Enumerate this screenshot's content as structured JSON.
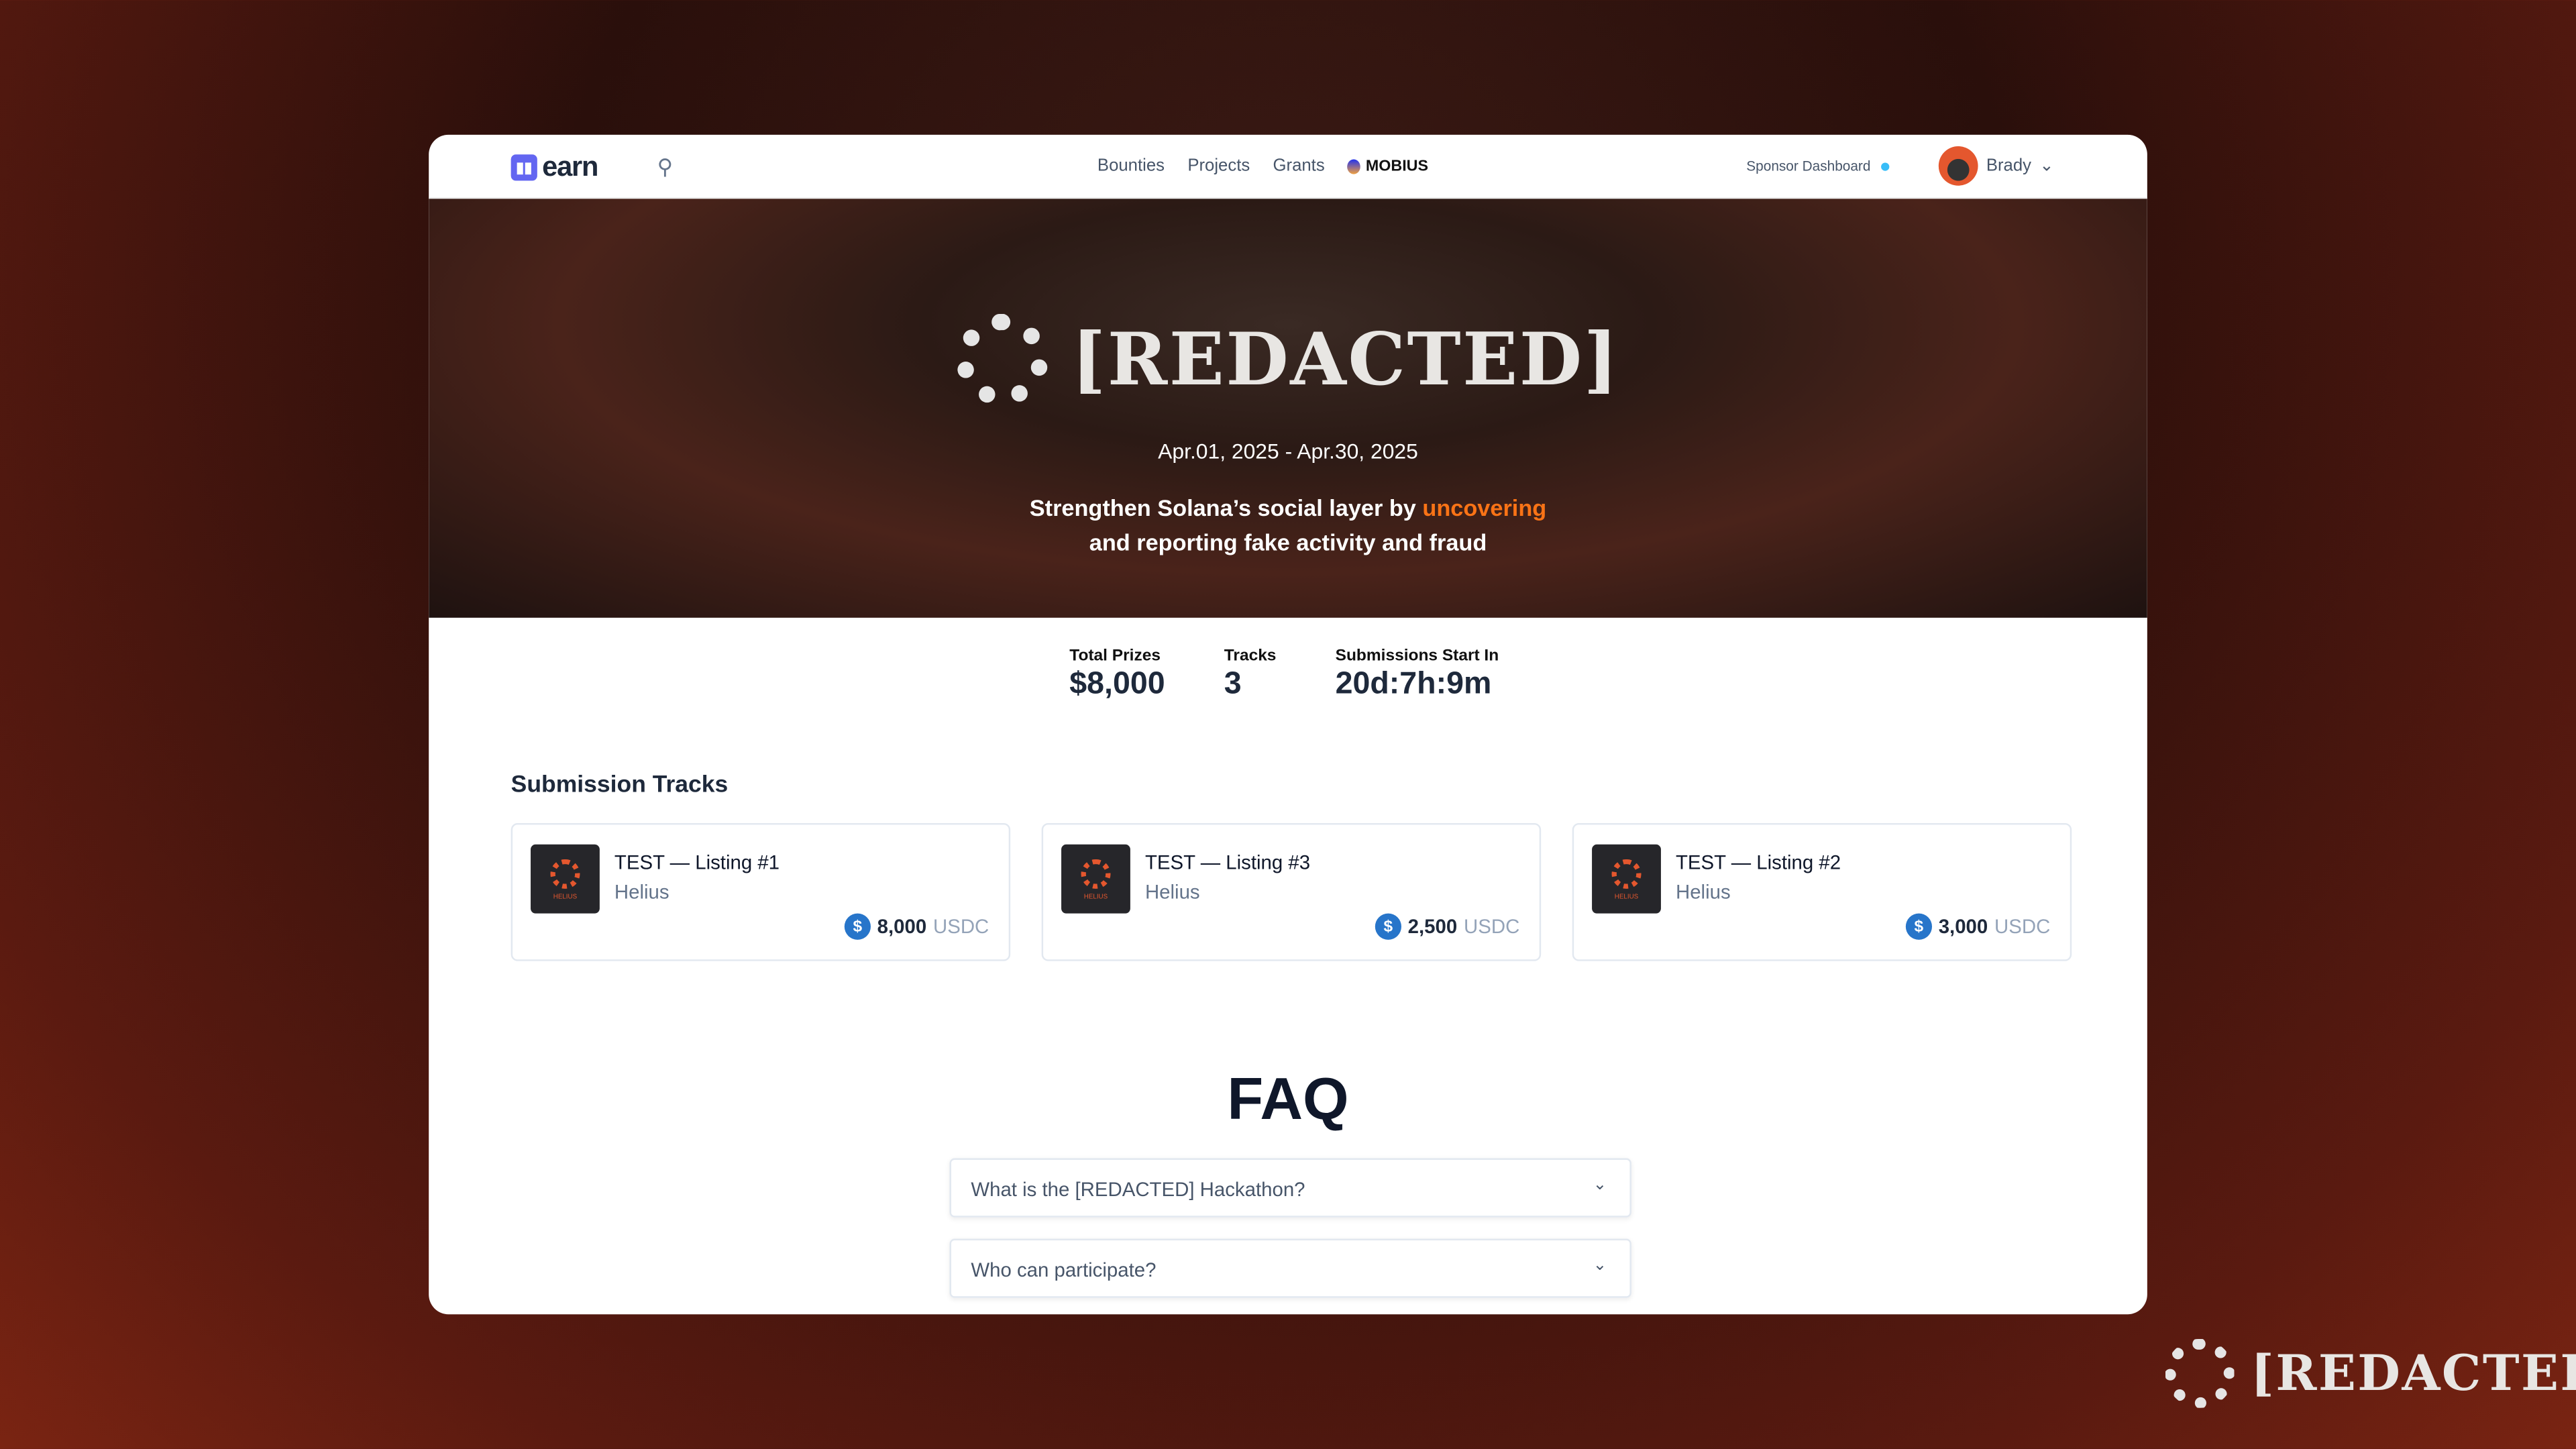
{
  "nav": {
    "logo": "earn",
    "links": [
      "Bounties",
      "Projects",
      "Grants"
    ],
    "mobius": "MOBIUS",
    "sponsor": "Sponsor Dashboard",
    "user": "Brady"
  },
  "hero": {
    "title": "[REDACTED]",
    "dates": "Apr.01, 2025 - Apr.30, 2025",
    "tagline_pre": "Strengthen Solana’s social layer by ",
    "tagline_hl": "uncovering",
    "tagline_post": " and reporting fake activity and fraud",
    "accent": "#f97316"
  },
  "stats": [
    {
      "label": "Total Prizes",
      "value": "$8,000"
    },
    {
      "label": "Tracks",
      "value": "3"
    },
    {
      "label": "Submissions Start In",
      "value": "20d:7h:9m"
    }
  ],
  "tracks_heading": "Submission Tracks",
  "tracks": [
    {
      "title": "TEST — Listing #1",
      "sponsor": "Helius",
      "amount": "8,000",
      "token": "USDC",
      "logo_text": "HELIUS"
    },
    {
      "title": "TEST — Listing #3",
      "sponsor": "Helius",
      "amount": "2,500",
      "token": "USDC",
      "logo_text": "HELIUS"
    },
    {
      "title": "TEST — Listing #2",
      "sponsor": "Helius",
      "amount": "3,000",
      "token": "USDC",
      "logo_text": "HELIUS"
    }
  ],
  "faq": {
    "heading": "FAQ",
    "items": [
      "What is the [REDACTED] Hackathon?",
      "Who can participate?"
    ]
  },
  "brand": "[REDACTED]"
}
